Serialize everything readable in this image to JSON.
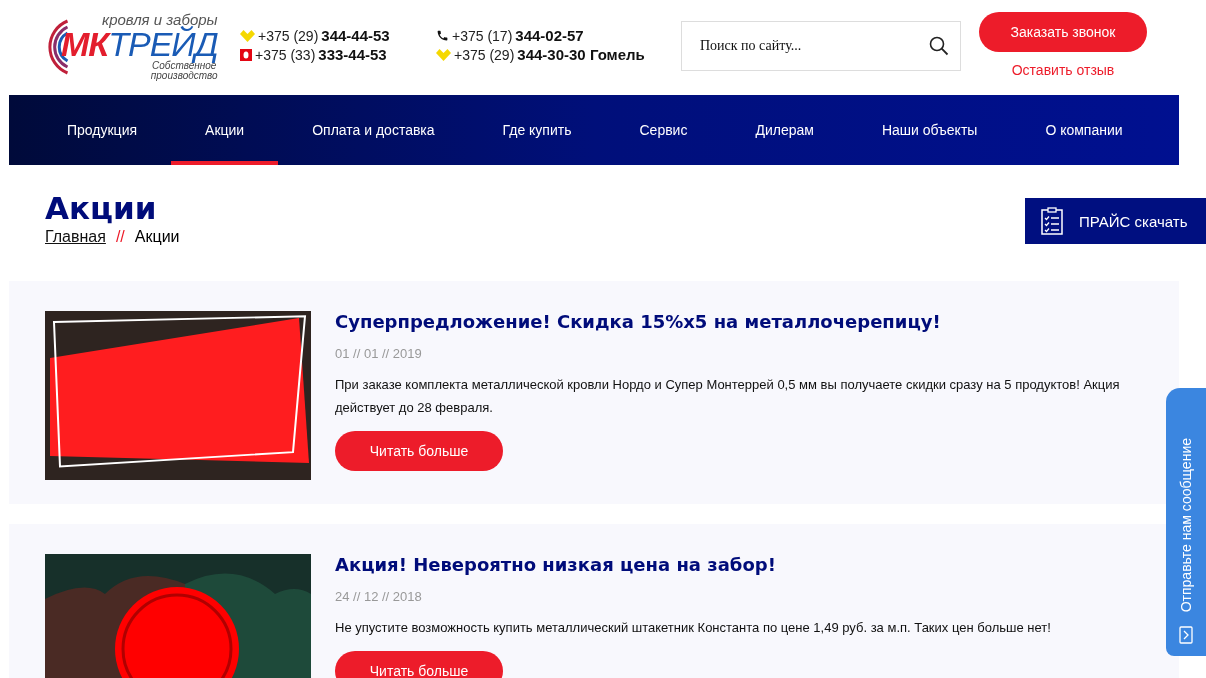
{
  "logo": {
    "tagline": "кровля и заборы",
    "brand_a": "МК",
    "brand_b": "ТРЕЙД",
    "subtitle_1": "Собственное",
    "subtitle_2": "производство"
  },
  "phones": [
    [
      {
        "kind": "heart",
        "code": "+375 (29)",
        "number": "344-44-53"
      },
      {
        "kind": "square",
        "code": "+375 (33)",
        "number": "333-44-53"
      }
    ],
    [
      {
        "kind": "phone",
        "code": "+375 (17)",
        "number": "344-02-57"
      },
      {
        "kind": "heart",
        "code": "+375 (29)",
        "number": "344-30-30 Гомель"
      }
    ]
  ],
  "search": {
    "placeholder": "Поиск по сайту..."
  },
  "callback_button": "Заказать звонок",
  "review_link": "Оставить отзыв",
  "nav": [
    {
      "label": "Продукция",
      "selected": false
    },
    {
      "label": "Акции",
      "selected": true
    },
    {
      "label": "Оплата и доставка",
      "selected": false
    },
    {
      "label": "Где купить",
      "selected": false
    },
    {
      "label": "Сервис",
      "selected": false
    },
    {
      "label": "Дилерам",
      "selected": false
    },
    {
      "label": "Наши объекты",
      "selected": false
    },
    {
      "label": "О компании",
      "selected": false
    }
  ],
  "page_title": "Акции",
  "breadcrumbs": [
    {
      "label": "Главная",
      "link": true
    },
    {
      "label": "Акции",
      "link": false
    }
  ],
  "breadcrumb_separator": "//",
  "price_button": "ПРАЙС скачать",
  "promos": [
    {
      "kind": "discount",
      "title": "Суперпредложение! Скидка 15%х5 на металлочерепицу!",
      "date": "01 // 01 // 2019",
      "text": "При заказе комплекта металлической кровли Нордо и Супер Монтеррей 0,5 мм вы получаете скидки сразу на 5 продуктов! Акция действует до 28 февраля.",
      "button": "Читать больше"
    },
    {
      "kind": "fence",
      "title": "Акция! Невероятно низкая цена на забор!",
      "date": "24 // 12 // 2018",
      "text": "Не упустите возможность купить металлический штакетник Константа по цене 1,49 руб. за м.п. Таких цен больше нет!",
      "button": "Читать больше"
    }
  ],
  "message_tab": "Отправьте нам сообщение"
}
